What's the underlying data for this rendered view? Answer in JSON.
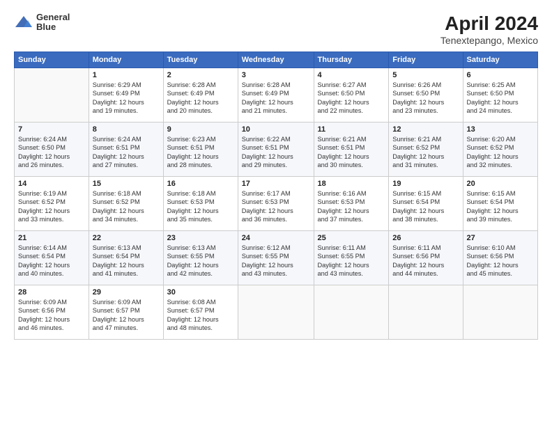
{
  "header": {
    "logo_line1": "General",
    "logo_line2": "Blue",
    "title": "April 2024",
    "subtitle": "Tenextepango, Mexico"
  },
  "days_of_week": [
    "Sunday",
    "Monday",
    "Tuesday",
    "Wednesday",
    "Thursday",
    "Friday",
    "Saturday"
  ],
  "weeks": [
    [
      {
        "day": "",
        "info": ""
      },
      {
        "day": "1",
        "info": "Sunrise: 6:29 AM\nSunset: 6:49 PM\nDaylight: 12 hours\nand 19 minutes."
      },
      {
        "day": "2",
        "info": "Sunrise: 6:28 AM\nSunset: 6:49 PM\nDaylight: 12 hours\nand 20 minutes."
      },
      {
        "day": "3",
        "info": "Sunrise: 6:28 AM\nSunset: 6:49 PM\nDaylight: 12 hours\nand 21 minutes."
      },
      {
        "day": "4",
        "info": "Sunrise: 6:27 AM\nSunset: 6:50 PM\nDaylight: 12 hours\nand 22 minutes."
      },
      {
        "day": "5",
        "info": "Sunrise: 6:26 AM\nSunset: 6:50 PM\nDaylight: 12 hours\nand 23 minutes."
      },
      {
        "day": "6",
        "info": "Sunrise: 6:25 AM\nSunset: 6:50 PM\nDaylight: 12 hours\nand 24 minutes."
      }
    ],
    [
      {
        "day": "7",
        "info": "Sunrise: 6:24 AM\nSunset: 6:50 PM\nDaylight: 12 hours\nand 26 minutes."
      },
      {
        "day": "8",
        "info": "Sunrise: 6:24 AM\nSunset: 6:51 PM\nDaylight: 12 hours\nand 27 minutes."
      },
      {
        "day": "9",
        "info": "Sunrise: 6:23 AM\nSunset: 6:51 PM\nDaylight: 12 hours\nand 28 minutes."
      },
      {
        "day": "10",
        "info": "Sunrise: 6:22 AM\nSunset: 6:51 PM\nDaylight: 12 hours\nand 29 minutes."
      },
      {
        "day": "11",
        "info": "Sunrise: 6:21 AM\nSunset: 6:51 PM\nDaylight: 12 hours\nand 30 minutes."
      },
      {
        "day": "12",
        "info": "Sunrise: 6:21 AM\nSunset: 6:52 PM\nDaylight: 12 hours\nand 31 minutes."
      },
      {
        "day": "13",
        "info": "Sunrise: 6:20 AM\nSunset: 6:52 PM\nDaylight: 12 hours\nand 32 minutes."
      }
    ],
    [
      {
        "day": "14",
        "info": "Sunrise: 6:19 AM\nSunset: 6:52 PM\nDaylight: 12 hours\nand 33 minutes."
      },
      {
        "day": "15",
        "info": "Sunrise: 6:18 AM\nSunset: 6:52 PM\nDaylight: 12 hours\nand 34 minutes."
      },
      {
        "day": "16",
        "info": "Sunrise: 6:18 AM\nSunset: 6:53 PM\nDaylight: 12 hours\nand 35 minutes."
      },
      {
        "day": "17",
        "info": "Sunrise: 6:17 AM\nSunset: 6:53 PM\nDaylight: 12 hours\nand 36 minutes."
      },
      {
        "day": "18",
        "info": "Sunrise: 6:16 AM\nSunset: 6:53 PM\nDaylight: 12 hours\nand 37 minutes."
      },
      {
        "day": "19",
        "info": "Sunrise: 6:15 AM\nSunset: 6:54 PM\nDaylight: 12 hours\nand 38 minutes."
      },
      {
        "day": "20",
        "info": "Sunrise: 6:15 AM\nSunset: 6:54 PM\nDaylight: 12 hours\nand 39 minutes."
      }
    ],
    [
      {
        "day": "21",
        "info": "Sunrise: 6:14 AM\nSunset: 6:54 PM\nDaylight: 12 hours\nand 40 minutes."
      },
      {
        "day": "22",
        "info": "Sunrise: 6:13 AM\nSunset: 6:54 PM\nDaylight: 12 hours\nand 41 minutes."
      },
      {
        "day": "23",
        "info": "Sunrise: 6:13 AM\nSunset: 6:55 PM\nDaylight: 12 hours\nand 42 minutes."
      },
      {
        "day": "24",
        "info": "Sunrise: 6:12 AM\nSunset: 6:55 PM\nDaylight: 12 hours\nand 43 minutes."
      },
      {
        "day": "25",
        "info": "Sunrise: 6:11 AM\nSunset: 6:55 PM\nDaylight: 12 hours\nand 43 minutes."
      },
      {
        "day": "26",
        "info": "Sunrise: 6:11 AM\nSunset: 6:56 PM\nDaylight: 12 hours\nand 44 minutes."
      },
      {
        "day": "27",
        "info": "Sunrise: 6:10 AM\nSunset: 6:56 PM\nDaylight: 12 hours\nand 45 minutes."
      }
    ],
    [
      {
        "day": "28",
        "info": "Sunrise: 6:09 AM\nSunset: 6:56 PM\nDaylight: 12 hours\nand 46 minutes."
      },
      {
        "day": "29",
        "info": "Sunrise: 6:09 AM\nSunset: 6:57 PM\nDaylight: 12 hours\nand 47 minutes."
      },
      {
        "day": "30",
        "info": "Sunrise: 6:08 AM\nSunset: 6:57 PM\nDaylight: 12 hours\nand 48 minutes."
      },
      {
        "day": "",
        "info": ""
      },
      {
        "day": "",
        "info": ""
      },
      {
        "day": "",
        "info": ""
      },
      {
        "day": "",
        "info": ""
      }
    ]
  ]
}
